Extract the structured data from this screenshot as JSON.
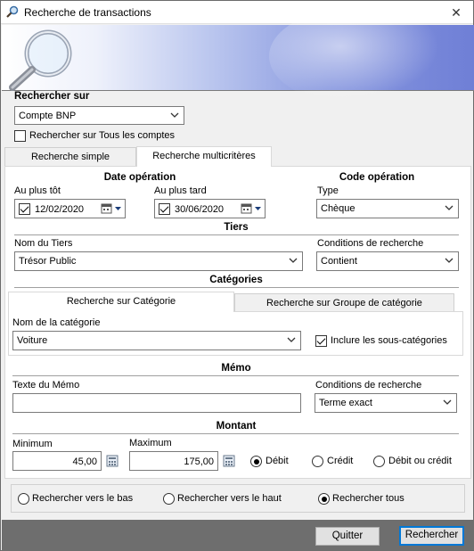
{
  "window": {
    "title": "Recherche de transactions",
    "close_label": "✕"
  },
  "search_on": {
    "label": "Rechercher sur",
    "account_value": "Compte BNP",
    "all_accounts_label": "Rechercher sur Tous les comptes",
    "all_accounts_checked": false
  },
  "tabs": [
    "Recherche simple",
    "Recherche multicritères"
  ],
  "active_tab": 1,
  "date_op": {
    "title": "Date opération",
    "from_label": "Au plus tôt",
    "from_value": "12/02/2020",
    "to_label": "Au plus tard",
    "to_value": "30/06/2020"
  },
  "code_op": {
    "title": "Code opération",
    "type_label": "Type",
    "type_value": "Chèque"
  },
  "tiers": {
    "title": "Tiers",
    "name_label": "Nom du Tiers",
    "name_value": "Trésor Public",
    "cond_label": "Conditions de recherche",
    "cond_value": "Contient"
  },
  "categories": {
    "title": "Catégories",
    "tabs": [
      "Recherche sur Catégorie",
      "Recherche sur Groupe de catégorie"
    ],
    "name_label": "Nom de la catégorie",
    "name_value": "Voiture",
    "include_sub_label": "Inclure les sous-catégories",
    "include_sub_checked": true
  },
  "memo": {
    "title": "Mémo",
    "text_label": "Texte du Mémo",
    "text_value": "",
    "cond_label": "Conditions de recherche",
    "cond_value": "Terme exact"
  },
  "amount": {
    "title": "Montant",
    "min_label": "Minimum",
    "min_value": "45,00",
    "max_label": "Maximum",
    "max_value": "175,00",
    "debit_label": "Débit",
    "credit_label": "Crédit",
    "both_label": "Débit ou crédit",
    "selected": "debit"
  },
  "direction": {
    "down_label": "Rechercher vers le bas",
    "up_label": "Rechercher vers le haut",
    "all_label": "Rechercher tous",
    "selected": "all"
  },
  "buttons": {
    "quit": "Quitter",
    "search": "Rechercher"
  }
}
